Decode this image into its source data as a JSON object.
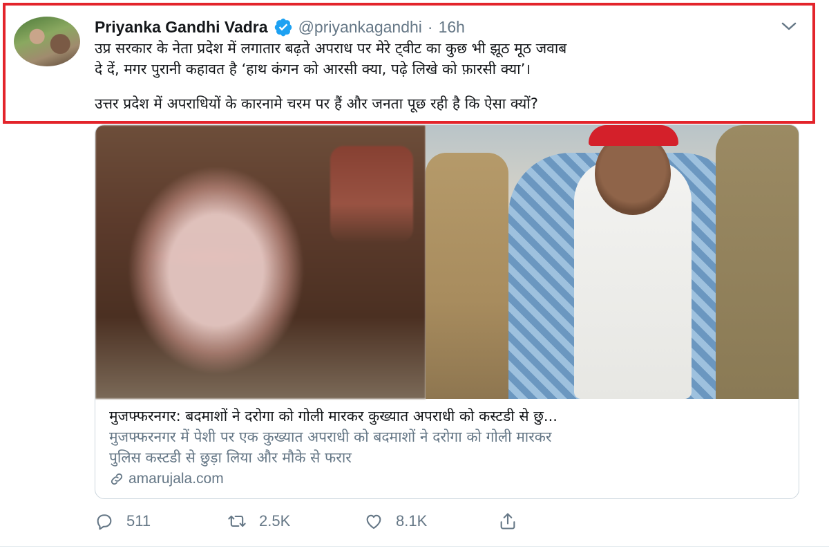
{
  "tweet": {
    "author_name": "Priyanka Gandhi Vadra",
    "handle": "@priyankagandhi",
    "separator": "·",
    "time": "16h",
    "text_lines": [
      "उप्र सरकार के नेता प्रदेश में लगातार बढ़ते अपराध पर मेरे ट्वीट का कुछ भी झूठ मूठ जवाब",
      "दे दें, मगर पुरानी कहावत है ‘हाथ कंगन को आरसी क्या, पढ़े लिखे को फ़ारसी क्या’।",
      "उत्तर प्रदेश में अपराधियों के कारनामे चरम पर हैं और जनता पूछ रही है कि ऐसा क्यों?"
    ]
  },
  "card": {
    "title": "मुजफ्फरनगर: बदमाशों ने दरोगा को गोली मारकर कुख्यात अपराधी को कस्टडी से छु...",
    "description_lines": [
      "मुजफ्फरनगर में पेशी पर एक कुख्यात अपराधी को बदमाशों ने दरोगा को गोली मारकर",
      "पुलिस कस्टडी से छुड़ा लिया और मौके से फरार"
    ],
    "domain": "amarujala.com"
  },
  "actions": {
    "replies": "511",
    "retweets": "2.5K",
    "likes": "8.1K"
  },
  "colors": {
    "highlight_border": "#e3242b",
    "verified": "#1da1f2",
    "secondary_text": "#657786"
  },
  "icons": [
    "verified-badge-icon",
    "chevron-down-icon",
    "link-icon",
    "reply-icon",
    "retweet-icon",
    "like-icon",
    "share-icon"
  ]
}
